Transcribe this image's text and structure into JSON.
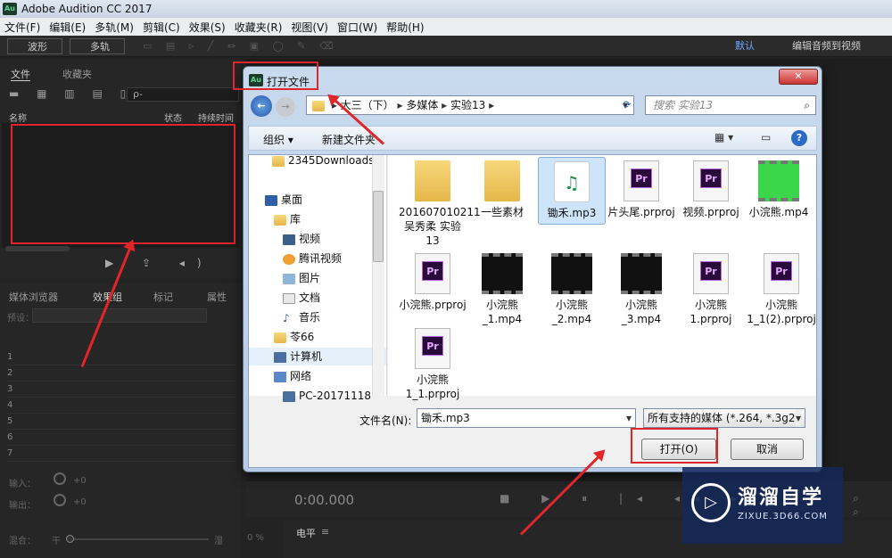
{
  "app": {
    "title": "Adobe Audition CC 2017",
    "logo": "Au"
  },
  "menu": [
    "文件(F)",
    "编辑(E)",
    "多轨(M)",
    "剪辑(C)",
    "效果(S)",
    "收藏夹(R)",
    "视图(V)",
    "窗口(W)",
    "帮助(H)"
  ],
  "toolbar": {
    "waveform": "波形",
    "multitrack": "多轨",
    "default": "默认",
    "workspace": "编辑音频到视频"
  },
  "files_panel": {
    "tab_files": "文件",
    "tab_favorites": "收藏夹",
    "col_name": "名称",
    "col_status": "状态",
    "col_duration": "持续时间",
    "search_placeholder": "ρ-"
  },
  "lower_panel": {
    "tabs": [
      "媒体浏览器",
      "效果组",
      "标记",
      "属性"
    ],
    "preset_label": "预设：",
    "rows": [
      "1",
      "2",
      "3",
      "4",
      "5",
      "6",
      "7"
    ],
    "input_label": "输入：",
    "output_label": "输出：",
    "mix_label": "混合：",
    "dry": "干",
    "wet": "湿",
    "db_in": "+0",
    "db_out": "+0",
    "mix_pct": "0 %"
  },
  "transport": {
    "time": "0:00.000",
    "level": "电平"
  },
  "dialog": {
    "title": "打开文件",
    "breadcrumb": [
      "大三（下）",
      "多媒体",
      "实验13"
    ],
    "search_placeholder": "搜索 实验13",
    "organize": "组织 ▾",
    "new_folder": "新建文件夹",
    "tree": [
      "2345Downloads",
      "桌面",
      "库",
      "视频",
      "腾讯视频",
      "图片",
      "文档",
      "音乐",
      "苓66",
      "计算机",
      "网络",
      "PC-20171118"
    ],
    "files": [
      {
        "name": "201607010211 吴秀柔 实验13",
        "type": "folder"
      },
      {
        "name": "一些素材",
        "type": "folder"
      },
      {
        "name": "锄禾.mp3",
        "type": "audio"
      },
      {
        "name": "片头尾.prproj",
        "type": "prproj"
      },
      {
        "name": "视频.prproj",
        "type": "prproj"
      },
      {
        "name": "小浣熊.mp4",
        "type": "video-green"
      },
      {
        "name": "小浣熊.prproj",
        "type": "prproj"
      },
      {
        "name": "小浣熊_1.mp4",
        "type": "video"
      },
      {
        "name": "小浣熊_2.mp4",
        "type": "video"
      },
      {
        "name": "小浣熊_3.mp4",
        "type": "video"
      },
      {
        "name": "小浣熊1.prproj",
        "type": "prproj"
      },
      {
        "name": "小浣熊1_1(2).prproj",
        "type": "prproj"
      },
      {
        "name": "小浣熊1_1.prproj",
        "type": "prproj"
      }
    ],
    "filename_label": "文件名(N):",
    "filename_value": "锄禾.mp3",
    "filetype_value": "所有支持的媒体 (*.264, *.3g2,",
    "open_button": "打开(O)",
    "cancel_button": "取消"
  },
  "watermark": {
    "title": "溜溜自学",
    "url": "ZIXUE.3D66.COM"
  }
}
